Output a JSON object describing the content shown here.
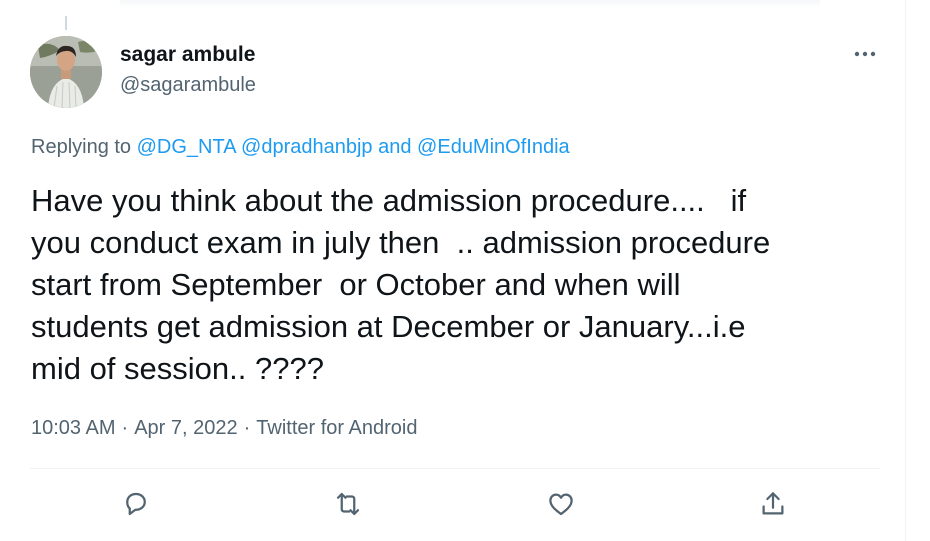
{
  "tweet": {
    "author": {
      "display_name": "sagar ambule",
      "handle": "@sagarambule",
      "avatar_icon": "profile-photo"
    },
    "replying_to": {
      "prefix": "Replying to",
      "mentions": [
        "@DG_NTA",
        "@dpradhanbjp",
        "@EduMinOfIndia"
      ],
      "connector": "and"
    },
    "text": "Have you think about the admission procedure....   if\nyou conduct exam in july then  .. admission procedure\nstart from September  or October and when will\nstudents get admission at December or January...i.e\nmid of session.. ????",
    "time": "10:03 AM",
    "date": "Apr 7, 2022",
    "source": "Twitter for Android",
    "separator": "·"
  },
  "actions": [
    {
      "name": "reply",
      "icon": "reply-icon"
    },
    {
      "name": "retweet",
      "icon": "retweet-icon"
    },
    {
      "name": "like",
      "icon": "heart-icon"
    },
    {
      "name": "share",
      "icon": "share-icon"
    }
  ],
  "menu": {
    "icon": "more-icon"
  },
  "colors": {
    "accent": "#1d9bf0",
    "secondary_text": "#536471",
    "primary_text": "#0f1419",
    "divider": "#eff3f4"
  }
}
